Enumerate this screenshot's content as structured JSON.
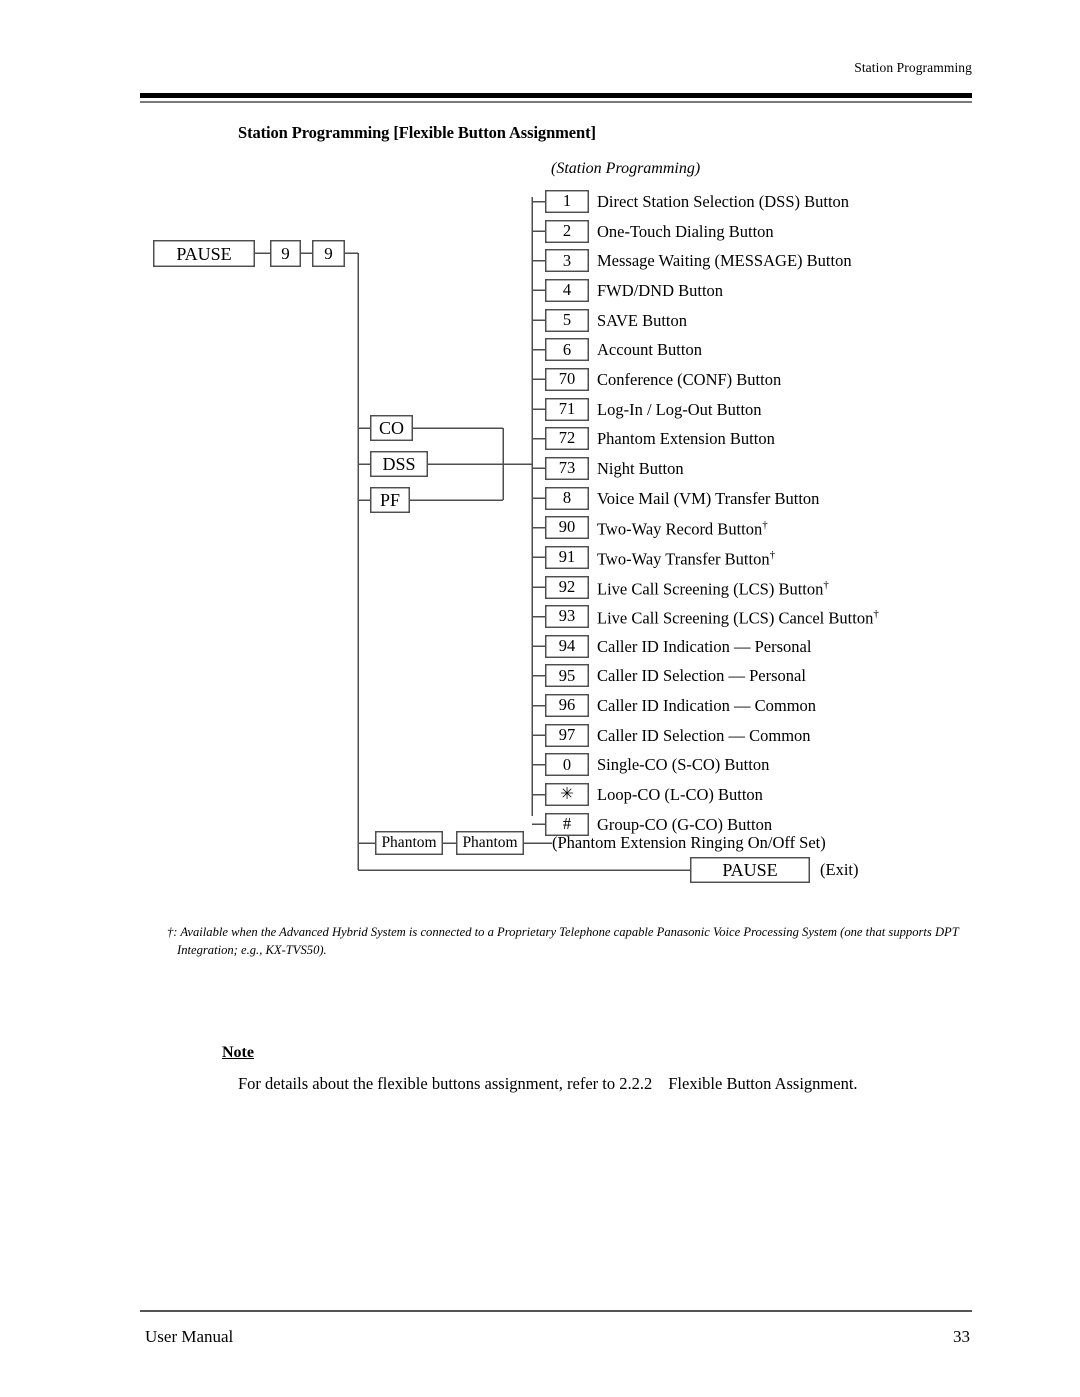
{
  "page": {
    "running_head": "Station Programming",
    "section_title": "Station Programming [Flexible Button Assignment]",
    "sub_title": "(Station Programming)"
  },
  "diagram": {
    "entry": {
      "pause_label": "PAUSE",
      "digit_1": "9",
      "digit_2": "9"
    },
    "button_types": [
      {
        "code": "CO",
        "name": "co-box"
      },
      {
        "code": "DSS",
        "name": "dss-box"
      },
      {
        "code": "PF",
        "name": "pf-box"
      }
    ],
    "rows": [
      {
        "code": "1",
        "label": "Direct Station Selection (DSS) Button",
        "dagger": false
      },
      {
        "code": "2",
        "label": "One-Touch Dialing Button",
        "dagger": false
      },
      {
        "code": "3",
        "label": "Message Waiting (MESSAGE) Button",
        "dagger": false
      },
      {
        "code": "4",
        "label": "FWD/DND Button",
        "dagger": false
      },
      {
        "code": "5",
        "label": "SAVE Button",
        "dagger": false
      },
      {
        "code": "6",
        "label": "Account Button",
        "dagger": false
      },
      {
        "code": "70",
        "label": "Conference (CONF) Button",
        "dagger": false
      },
      {
        "code": "71",
        "label": "Log-In / Log-Out Button",
        "dagger": false
      },
      {
        "code": "72",
        "label": "Phantom Extension Button",
        "dagger": false
      },
      {
        "code": "73",
        "label": "Night Button",
        "dagger": false
      },
      {
        "code": "8",
        "label": "Voice Mail (VM) Transfer Button",
        "dagger": false
      },
      {
        "code": "90",
        "label": "Two-Way Record Button",
        "dagger": true
      },
      {
        "code": "91",
        "label": "Two-Way Transfer Button",
        "dagger": true
      },
      {
        "code": "92",
        "label": "Live Call Screening (LCS) Button",
        "dagger": true
      },
      {
        "code": "93",
        "label": "Live Call Screening (LCS) Cancel Button",
        "dagger": true
      },
      {
        "code": "94",
        "label": "Caller ID Indication — Personal",
        "dagger": false
      },
      {
        "code": "95",
        "label": "Caller ID Selection — Personal",
        "dagger": false
      },
      {
        "code": "96",
        "label": "Caller ID Indication — Common",
        "dagger": false
      },
      {
        "code": "97",
        "label": "Caller ID Selection — Common",
        "dagger": false
      },
      {
        "code": "0",
        "label": "Single-CO (S-CO) Button",
        "dagger": false
      },
      {
        "code": "✳",
        "label": "Loop-CO (L-CO) Button",
        "dagger": false
      },
      {
        "code": "#",
        "label": "Group-CO (G-CO) Button",
        "dagger": false
      }
    ],
    "phantom_row": {
      "box_1": "Phantom",
      "box_2": "Phantom",
      "label": "(Phantom Extension Ringing On/Off Set)"
    },
    "exit_row": {
      "pause_label": "PAUSE",
      "label": "(Exit)"
    }
  },
  "footnote": "†: Available when the Advanced Hybrid System is connected to a Proprietary Telephone capable Panasonic Voice Processing System (one that supports DPT Integration; e.g., KX-TVS50).",
  "note": {
    "heading": "Note",
    "body_part_1": "For details about the flexible buttons assignment, refer to 2.2.2",
    "body_part_2": "Flexible Button Assignment."
  },
  "footer": {
    "left": "User Manual",
    "page_number": "33"
  }
}
